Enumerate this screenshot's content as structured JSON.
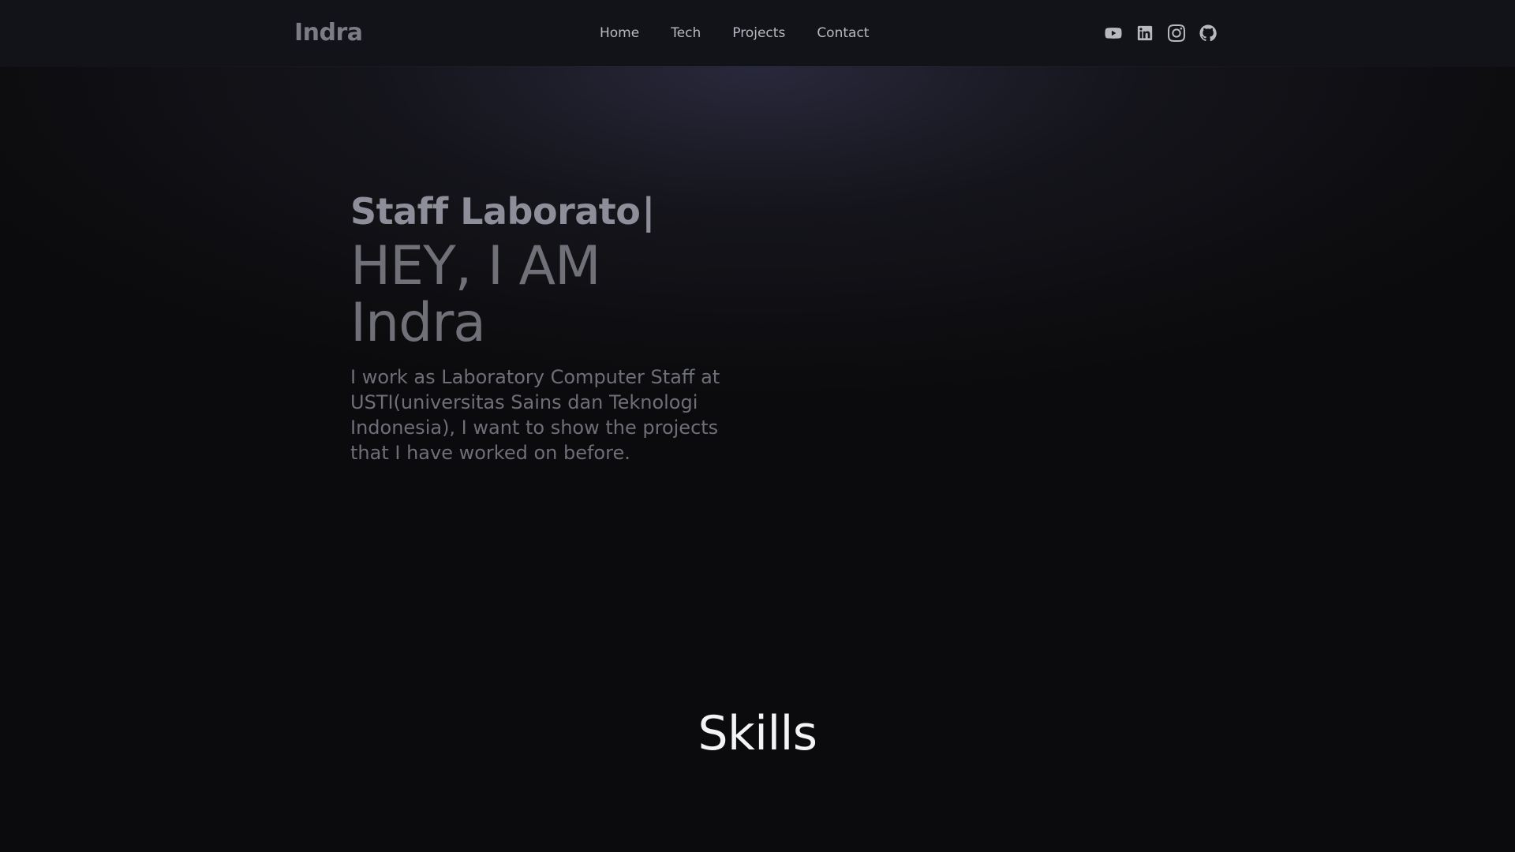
{
  "navbar": {
    "brand": "Indra",
    "links": [
      {
        "label": "Home"
      },
      {
        "label": "Tech"
      },
      {
        "label": "Projects"
      },
      {
        "label": "Contact"
      }
    ],
    "social": [
      {
        "icon": "youtube-icon"
      },
      {
        "icon": "linkedin-icon"
      },
      {
        "icon": "instagram-icon"
      },
      {
        "icon": "github-icon"
      }
    ]
  },
  "hero": {
    "typed_text": "Staff Laborato",
    "typed_cursor": "|",
    "greeting": "HEY, I AM",
    "name": "Indra",
    "intro": "I work as Laboratory Computer Staff at USTI(universitas Sains dan Teknologi Indonesia), I want to show the projects that I have worked on before."
  },
  "skills": {
    "title": "Skills"
  },
  "colors": {
    "background": "#0b0b0d",
    "navbar": "#121319",
    "nav_text": "#b8b9bf",
    "hero_text": "#707078",
    "title_text": "#f3f4f6"
  }
}
